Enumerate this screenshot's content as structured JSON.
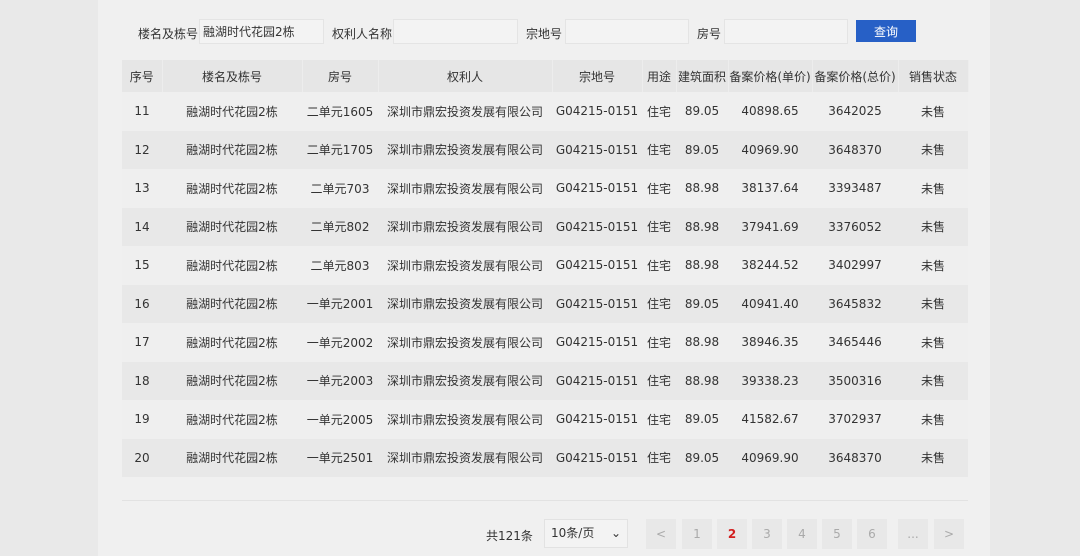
{
  "search": {
    "building_label": "楼名及栋号",
    "building_value": "融湖时代花园2栋",
    "owner_label": "权利人名称",
    "owner_value": "",
    "parcel_label": "宗地号",
    "parcel_value": "",
    "room_label": "房号",
    "room_value": "",
    "query_button": "查询"
  },
  "table": {
    "headers": [
      "序号",
      "楼名及栋号",
      "房号",
      "权利人",
      "宗地号",
      "用途",
      "建筑面积",
      "备案价格(单价)",
      "备案价格(总价)",
      "销售状态"
    ],
    "rows": [
      [
        "11",
        "融湖时代花园2栋",
        "二单元1605",
        "深圳市鼎宏投资发展有限公司",
        "G04215-0151",
        "住宅",
        "89.05",
        "40898.65",
        "3642025",
        "未售"
      ],
      [
        "12",
        "融湖时代花园2栋",
        "二单元1705",
        "深圳市鼎宏投资发展有限公司",
        "G04215-0151",
        "住宅",
        "89.05",
        "40969.90",
        "3648370",
        "未售"
      ],
      [
        "13",
        "融湖时代花园2栋",
        "二单元703",
        "深圳市鼎宏投资发展有限公司",
        "G04215-0151",
        "住宅",
        "88.98",
        "38137.64",
        "3393487",
        "未售"
      ],
      [
        "14",
        "融湖时代花园2栋",
        "二单元802",
        "深圳市鼎宏投资发展有限公司",
        "G04215-0151",
        "住宅",
        "88.98",
        "37941.69",
        "3376052",
        "未售"
      ],
      [
        "15",
        "融湖时代花园2栋",
        "二单元803",
        "深圳市鼎宏投资发展有限公司",
        "G04215-0151",
        "住宅",
        "88.98",
        "38244.52",
        "3402997",
        "未售"
      ],
      [
        "16",
        "融湖时代花园2栋",
        "一单元2001",
        "深圳市鼎宏投资发展有限公司",
        "G04215-0151",
        "住宅",
        "89.05",
        "40941.40",
        "3645832",
        "未售"
      ],
      [
        "17",
        "融湖时代花园2栋",
        "一单元2002",
        "深圳市鼎宏投资发展有限公司",
        "G04215-0151",
        "住宅",
        "88.98",
        "38946.35",
        "3465446",
        "未售"
      ],
      [
        "18",
        "融湖时代花园2栋",
        "一单元2003",
        "深圳市鼎宏投资发展有限公司",
        "G04215-0151",
        "住宅",
        "88.98",
        "39338.23",
        "3500316",
        "未售"
      ],
      [
        "19",
        "融湖时代花园2栋",
        "一单元2005",
        "深圳市鼎宏投资发展有限公司",
        "G04215-0151",
        "住宅",
        "89.05",
        "41582.67",
        "3702937",
        "未售"
      ],
      [
        "20",
        "融湖时代花园2栋",
        "一单元2501",
        "深圳市鼎宏投资发展有限公司",
        "G04215-0151",
        "住宅",
        "89.05",
        "40969.90",
        "3648370",
        "未售"
      ]
    ]
  },
  "pagination": {
    "total": "共121条",
    "page_size": "10条/页",
    "prev": "<",
    "pages": [
      "1",
      "2",
      "3",
      "4",
      "5",
      "6"
    ],
    "current": "2",
    "ellipsis": "...",
    "next": ">",
    "active_color": "#d32020"
  }
}
